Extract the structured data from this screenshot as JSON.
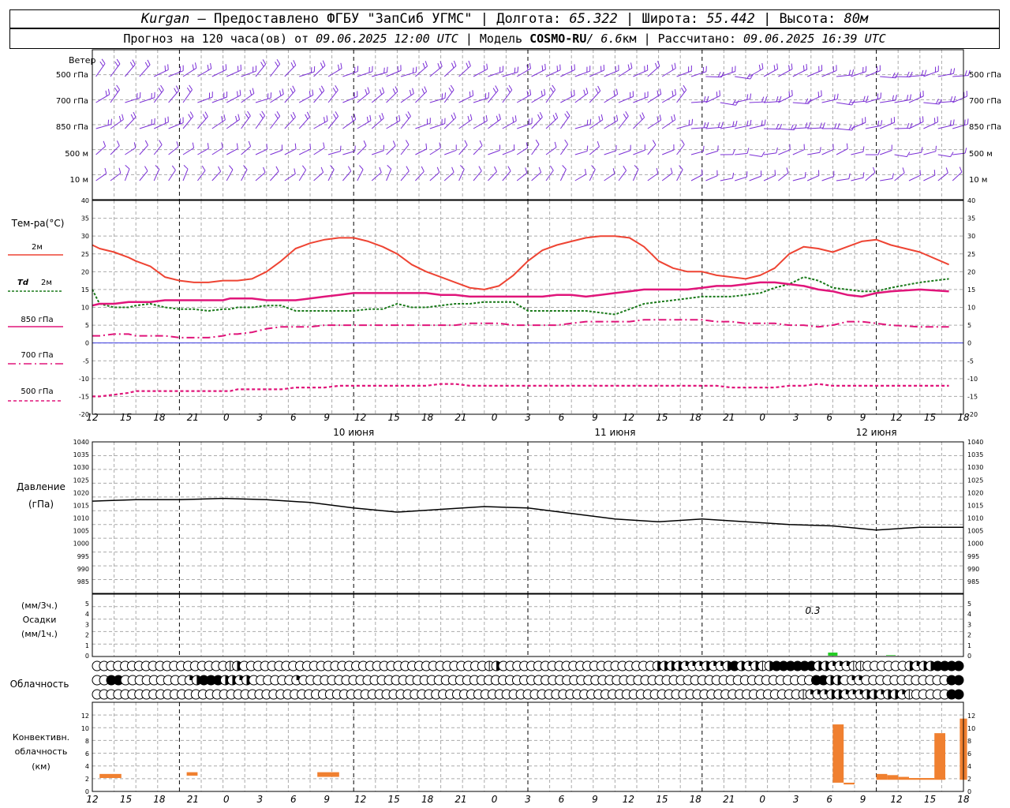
{
  "header": {
    "station": "Kurgan",
    "provider": "– Предоставлено ФГБУ \"ЗапСиб УГМС\" |",
    "lon_label": "Долгота:",
    "lon_value": "65.322",
    "lat_label": "| Широта:",
    "lat_value": "55.442",
    "alt_label": "| Высота:",
    "alt_value": "80м",
    "forecast_prefix": "Прогноз на 120 часа(ов) от",
    "forecast_date": "09.06.2025 12:00 UTC",
    "model_prefix": "| Модель",
    "model_name": "COSMO-RU",
    "model_res": "/ 6.6",
    "model_res_unit": "км",
    "calc_prefix": "| Рассчитано:",
    "calc_date": "09.06.2025 16:39 UTC"
  },
  "time_axis": {
    "hour_labels": [
      "12",
      "15",
      "18",
      "21",
      "0",
      "3",
      "6",
      "9",
      "12",
      "15",
      "18",
      "21",
      "0",
      "3",
      "6",
      "9",
      "12",
      "15",
      "18",
      "21",
      "0",
      "3",
      "6",
      "9",
      "12",
      "15",
      "18"
    ],
    "day_labels": [
      "10 июня",
      "11 июня",
      "12 июня"
    ]
  },
  "wind_panel": {
    "title": "Ветер",
    "levels": [
      "500 гПа",
      "700 гПа",
      "850 гПа",
      "500 м",
      "10 м"
    ],
    "color": "#7b2fd6"
  },
  "temperature_panel": {
    "title": "Тем-ра(°C)",
    "legend": [
      {
        "label": "2м",
        "color": "#ee4433",
        "style": "solid"
      },
      {
        "label_italic": "Td",
        "label": "2м",
        "color": "#1a7a1a",
        "style": "dotted"
      },
      {
        "label": "850 гПа",
        "color": "#e0157a",
        "style": "solid"
      },
      {
        "label": "700 гПа",
        "color": "#e0157a",
        "style": "dashdot"
      },
      {
        "label": "500 гПа",
        "color": "#e0157a",
        "style": "dashed"
      }
    ],
    "yticks": [
      "40",
      "35",
      "30",
      "25",
      "20",
      "15",
      "10",
      "5",
      "0",
      "-5",
      "-10",
      "-15",
      "-20"
    ]
  },
  "pressure_panel": {
    "title": "Давление",
    "unit": "(гПа)",
    "yticks": [
      "1040",
      "1035",
      "1030",
      "1025",
      "1020",
      "1015",
      "1010",
      "1005",
      "1000",
      "995",
      "990",
      "985"
    ]
  },
  "precip_panel": {
    "unit_3h": "(мм/3ч.)",
    "title": "Осадки",
    "unit_1h": "(мм/1ч.)",
    "yticks": [
      "5",
      "4",
      "3",
      "2",
      "1",
      "0"
    ],
    "annotation": "0.3"
  },
  "cloud_panel": {
    "title": "Облачность"
  },
  "convective_panel": {
    "title_1": "Конвективн.",
    "title_2": "облачность",
    "unit": "(км)",
    "yticks": [
      "12",
      "10",
      "8",
      "6",
      "4",
      "2",
      "0"
    ]
  },
  "chart_data": [
    {
      "type": "line",
      "title": "Тем-ра(°C)",
      "x_hours_from_start": [
        0,
        1,
        3,
        5,
        6,
        8,
        10,
        12,
        14,
        16,
        18,
        19,
        20,
        22,
        24,
        26,
        28,
        30,
        32,
        34,
        36,
        38,
        40,
        42,
        44,
        46,
        48,
        50,
        52,
        54,
        56,
        58,
        60,
        62,
        64,
        66,
        68,
        70,
        72,
        74,
        76,
        78,
        80,
        82,
        84,
        86,
        88,
        90,
        92,
        94,
        96,
        98,
        100,
        102,
        104,
        106,
        108,
        110,
        114,
        118
      ],
      "series": [
        {
          "name": "2м",
          "color": "#ee4433",
          "values": [
            27.5,
            26.5,
            25.5,
            24,
            23,
            21.5,
            18.5,
            17.5,
            17,
            17,
            17.5,
            17.5,
            17.5,
            18,
            20,
            23,
            26.5,
            28,
            29,
            29.5,
            29.5,
            28.5,
            27,
            25,
            22,
            20,
            18.5,
            17,
            15.5,
            15,
            16,
            19,
            23,
            26,
            27.5,
            28.5,
            29.5,
            30,
            30,
            29.5,
            27,
            23,
            21,
            20,
            20,
            19,
            18.5,
            18,
            19,
            21,
            25,
            27,
            26.5,
            25.5,
            27,
            28.5,
            29,
            27.5,
            25.5,
            22
          ]
        },
        {
          "name": "Td 2м",
          "color": "#1a7a1a",
          "values": [
            15,
            11,
            10,
            10,
            10.5,
            11,
            10,
            9.5,
            9.5,
            9,
            9.5,
            9.5,
            10,
            10,
            10.5,
            10.5,
            9,
            9,
            9,
            9,
            9,
            9.5,
            9.5,
            11,
            10,
            10,
            10.5,
            11,
            11,
            11.5,
            11.5,
            11.5,
            9,
            9,
            9,
            9,
            9,
            8.5,
            8,
            9.5,
            11,
            11.5,
            12,
            12.5,
            13,
            13,
            13,
            13.5,
            14,
            15.5,
            16.5,
            18.5,
            17.5,
            15.5,
            15,
            14.5,
            14.5,
            15.5,
            17,
            18
          ]
        },
        {
          "name": "850 гПа",
          "color": "#e0157a",
          "values": [
            10.5,
            11,
            11,
            11.5,
            11.5,
            11.5,
            12,
            12,
            12,
            12,
            12,
            12.5,
            12.5,
            12.5,
            12,
            12,
            12,
            12.5,
            13,
            13.5,
            14,
            14,
            14,
            14,
            14,
            14,
            13.5,
            13.5,
            13,
            13,
            13,
            13,
            13,
            13,
            13.5,
            13.5,
            13,
            13.5,
            14,
            14.5,
            15,
            15,
            15,
            15,
            15.5,
            16,
            16,
            16.5,
            17,
            17,
            16.5,
            16,
            15,
            14.5,
            13.5,
            13,
            14,
            14.5,
            15,
            14.5
          ]
        },
        {
          "name": "700 гПа",
          "color": "#e0157a",
          "values": [
            2,
            2,
            2.5,
            2.5,
            2,
            2,
            2,
            1.5,
            1.5,
            1.5,
            2,
            2.5,
            2.5,
            3,
            4,
            4.5,
            4.5,
            4.5,
            5,
            5,
            5,
            5,
            5,
            5,
            5,
            5,
            5,
            5,
            5.5,
            5.5,
            5.5,
            5,
            5,
            5,
            5,
            5.5,
            6,
            6,
            6,
            6,
            6.5,
            6.5,
            6.5,
            6.5,
            6.5,
            6,
            6,
            5.5,
            5.5,
            5.5,
            5,
            5,
            4.5,
            5,
            6,
            6,
            5.5,
            5,
            4.5,
            4.5
          ]
        },
        {
          "name": "500 гПа",
          "color": "#e0157a",
          "values": [
            -15,
            -15,
            -14.5,
            -14,
            -13.5,
            -13.5,
            -13.5,
            -13.5,
            -13.5,
            -13.5,
            -13.5,
            -13.5,
            -13,
            -13,
            -13,
            -13,
            -12.5,
            -12.5,
            -12.5,
            -12,
            -12,
            -12,
            -12,
            -12,
            -12,
            -12,
            -11.5,
            -11.5,
            -12,
            -12,
            -12,
            -12,
            -12,
            -12,
            -12,
            -12,
            -12,
            -12,
            -12,
            -12,
            -12,
            -12,
            -12,
            -12,
            -12,
            -12,
            -12.5,
            -12.5,
            -12.5,
            -12.5,
            -12,
            -12,
            -11.5,
            -12,
            -12,
            -12,
            -12,
            -12,
            -12,
            -12
          ]
        }
      ],
      "ylim": [
        -20,
        40
      ],
      "xlim": [
        0,
        120
      ]
    },
    {
      "type": "line",
      "title": "Давление",
      "ylabel": "(гПа)",
      "x_hours_from_start": [
        0,
        6,
        12,
        18,
        24,
        30,
        36,
        42,
        48,
        54,
        60,
        66,
        72,
        78,
        84,
        90,
        96,
        102,
        108,
        114,
        120
      ],
      "series": [
        {
          "name": "",
          "color": "#000000",
          "values": [
            1018.5,
            1019,
            1019,
            1019.5,
            1019,
            1018,
            1016,
            1014.5,
            1015.5,
            1016.5,
            1016,
            1014,
            1012,
            1011,
            1012,
            1011,
            1010,
            1009.5,
            1008,
            1009,
            1009
          ]
        }
      ],
      "ylim": [
        985,
        1040
      ]
    },
    {
      "type": "bar",
      "title": "Осадки",
      "ylabel": "(мм/3ч.)",
      "x_hours_from_start": [
        102,
        110
      ],
      "values": [
        0.3,
        0.05
      ],
      "color": "#22cc22",
      "ylim": [
        0,
        5
      ]
    },
    {
      "type": "bar",
      "title": "Конвективн. облачность",
      "ylabel": "(км)",
      "bars": [
        {
          "x0": 1,
          "x1": 4,
          "base": 2.3,
          "top": 3.0
        },
        {
          "x0": 13,
          "x1": 14.5,
          "base": 2.7,
          "top": 3.3
        },
        {
          "x0": 31,
          "x1": 34,
          "base": 2.5,
          "top": 3.3
        },
        {
          "x0": 102,
          "x1": 103.5,
          "base": 1.5,
          "top": 11.5
        },
        {
          "x0": 103.5,
          "x1": 105,
          "base": 1.2,
          "top": 1.5
        },
        {
          "x0": 108,
          "x1": 109.5,
          "base": 2.0,
          "top": 3.0
        },
        {
          "x0": 109.5,
          "x1": 111,
          "base": 2.0,
          "top": 2.8
        },
        {
          "x0": 111,
          "x1": 112.5,
          "base": 2.0,
          "top": 2.5
        },
        {
          "x0": 112.5,
          "x1": 116,
          "base": 2.0,
          "top": 2.3
        },
        {
          "x0": 116,
          "x1": 117.5,
          "base": 2.0,
          "top": 10.0
        },
        {
          "x0": 119.5,
          "x1": 120.5,
          "base": 2.0,
          "top": 12.5
        }
      ],
      "color": "#f08030",
      "ylim": [
        0,
        13
      ]
    },
    {
      "type": "table",
      "title": "Облачность",
      "rows": [
        [
          0,
          0,
          0,
          0,
          0,
          0,
          0,
          0,
          0,
          0,
          0,
          0,
          0,
          0,
          0,
          0,
          0,
          0,
          0,
          1,
          3,
          0,
          0,
          0,
          0,
          0,
          0,
          0,
          0,
          0,
          0,
          0,
          0,
          0,
          0,
          0,
          0,
          0,
          0,
          0,
          0,
          0,
          0,
          0,
          0,
          0,
          0,
          0,
          0,
          0,
          0,
          0,
          0,
          0,
          0,
          0,
          1,
          3,
          0,
          0,
          0,
          0,
          0,
          0,
          0,
          0,
          0,
          0,
          0,
          0,
          0,
          0,
          0,
          0,
          0,
          0,
          0,
          0,
          0,
          0,
          3,
          3,
          3,
          3,
          2,
          2,
          2,
          3,
          2,
          2,
          3,
          4,
          3,
          2,
          3,
          1,
          3,
          4,
          4,
          4,
          4,
          4,
          4,
          3,
          3,
          2,
          2,
          2,
          1,
          1,
          0,
          0,
          0,
          0,
          0,
          0,
          3,
          2,
          3,
          3,
          4,
          4,
          4,
          4
        ],
        [
          0,
          0,
          4,
          4,
          0,
          0,
          0,
          0,
          0,
          0,
          0,
          0,
          0,
          2,
          3,
          4,
          4,
          4,
          3,
          3,
          2,
          3,
          0,
          0,
          0,
          0,
          0,
          0,
          2,
          0,
          0,
          0,
          0,
          0,
          0,
          0,
          0,
          0,
          0,
          0,
          0,
          0,
          0,
          0,
          0,
          0,
          0,
          0,
          0,
          0,
          0,
          0,
          0,
          0,
          0,
          0,
          0,
          0,
          0,
          0,
          0,
          0,
          0,
          0,
          0,
          0,
          0,
          0,
          0,
          0,
          0,
          0,
          0,
          0,
          0,
          0,
          0,
          0,
          0,
          0,
          0,
          0,
          0,
          0,
          0,
          0,
          0,
          0,
          0,
          0,
          0,
          0,
          0,
          0,
          0,
          0,
          0,
          0,
          0,
          0,
          0,
          4,
          4,
          3,
          3,
          0,
          2,
          2,
          0,
          0,
          0,
          0,
          0,
          0,
          0,
          0,
          0,
          0,
          0,
          0,
          4,
          4
        ],
        [
          0,
          0,
          0,
          0,
          0,
          0,
          0,
          0,
          0,
          0,
          0,
          0,
          0,
          0,
          0,
          0,
          0,
          0,
          0,
          0,
          0,
          0,
          0,
          0,
          0,
          0,
          0,
          0,
          0,
          0,
          0,
          0,
          0,
          0,
          0,
          0,
          0,
          0,
          0,
          0,
          0,
          0,
          0,
          0,
          0,
          0,
          0,
          0,
          0,
          0,
          0,
          0,
          0,
          0,
          0,
          0,
          0,
          0,
          0,
          0,
          0,
          0,
          0,
          0,
          0,
          0,
          0,
          0,
          0,
          0,
          0,
          0,
          0,
          0,
          0,
          0,
          0,
          0,
          0,
          0,
          0,
          0,
          0,
          0,
          0,
          0,
          0,
          0,
          0,
          0,
          0,
          0,
          0,
          0,
          0,
          0,
          0,
          0,
          0,
          0,
          1,
          2,
          2,
          2,
          3,
          3,
          2,
          2,
          2,
          3,
          3,
          2,
          3,
          3,
          2,
          1,
          0,
          0,
          0,
          0,
          0,
          4,
          4
        ]
      ]
    }
  ]
}
